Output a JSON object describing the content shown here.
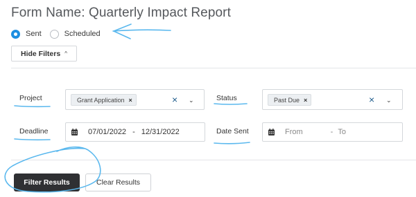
{
  "form": {
    "title": "Form Name: Quarterly Impact Report"
  },
  "delivery": {
    "options": [
      {
        "label": "Sent",
        "selected": true
      },
      {
        "label": "Scheduled",
        "selected": false
      }
    ]
  },
  "toggle": {
    "label": "Hide Filters"
  },
  "filters": {
    "project": {
      "label": "Project",
      "tag": "Grant Application"
    },
    "status": {
      "label": "Status",
      "tag": "Past Due"
    },
    "deadline": {
      "label": "Deadline",
      "from": "07/01/2022",
      "separator": "-",
      "to": "12/31/2022"
    },
    "date_sent": {
      "label": "Date Sent",
      "from_placeholder": "From",
      "separator": "-",
      "to_placeholder": "To"
    }
  },
  "actions": {
    "filter_label": "Filter Results",
    "clear_label": "Clear Results"
  },
  "colors": {
    "radio_selected": "#1d8fe1",
    "annotation": "#5ab8ee",
    "primary_button": "#2f3033",
    "clear_icon": "#1f5d8c"
  }
}
